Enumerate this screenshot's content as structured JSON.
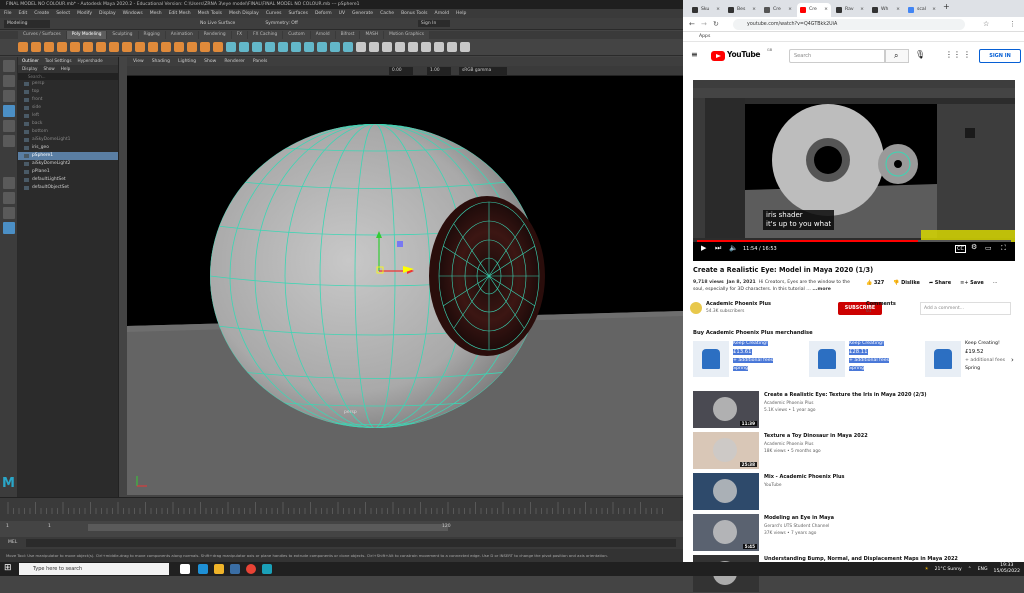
{
  "maya": {
    "title": "FINAL MODEL NO COLOUR.mb* - Autodesk Maya 2020.2 - Educational Version: C:\\Users\\ZRNA 3\\eye model\\FINAL\\FINAL MODEL NO COLOUR.mb --- pSphere1",
    "menu": [
      "File",
      "Edit",
      "Create",
      "Select",
      "Modify",
      "Display",
      "Windows",
      "Mesh",
      "Edit Mesh",
      "Mesh Tools",
      "Mesh Display",
      "Curves",
      "Surfaces",
      "Deform",
      "UV",
      "Generate",
      "Cache",
      "Bonus Tools",
      "Arnold",
      "Help"
    ],
    "mode": "Modeling",
    "no_live_surface": "No Live Surface",
    "symmetry": "Symmetry: Off",
    "sign_in": "Sign In",
    "shelf_tabs": [
      "Curves / Surfaces",
      "Poly Modeling",
      "Sculpting",
      "Rigging",
      "Animation",
      "Rendering",
      "FX",
      "FX Caching",
      "Custom",
      "Arnold",
      "Bifrost",
      "MASH",
      "Motion Graphics"
    ],
    "active_shelf": "Poly Modeling",
    "outliner_tabs": [
      "Outliner",
      "Tool Settings",
      "Hypershade"
    ],
    "outliner_menu": [
      "Display",
      "Show",
      "Help"
    ],
    "outliner_search": "Search...",
    "outliner_items": [
      "persp",
      "top",
      "front",
      "side",
      "left",
      "back",
      "bottom",
      "aiSkyDomeLight1",
      "iris_geo",
      "pSphere1",
      "aiSkyDomeLight2",
      "pPlane1",
      "defaultLightSet",
      "defaultObjectSet"
    ],
    "selected_item": "pSphere1",
    "viewport_menu": [
      "View",
      "Shading",
      "Lighting",
      "Show",
      "Renderer",
      "Panels"
    ],
    "field_1": "0.00",
    "field_2": "1.00",
    "colorspace": "sRGB gamma",
    "camera_label": "persp",
    "range_start": "1",
    "range_end": "120",
    "current_frame": "1",
    "mel_label": "MEL",
    "help_line": "Move Tool: Use manipulator to move object(s). Ctrl+middle-drag to move components along normals. Shift+drag manipulator axis or plane handles to extrude components or clone objects. Ctrl+Shift+Alt to constrain movement to a connected edge. Use D or INSERT to change the pivot position and axis orientation."
  },
  "chrome": {
    "tabs": [
      {
        "label": "Sku",
        "color": "#333333"
      },
      {
        "label": "Bes",
        "color": "#333333"
      },
      {
        "label": "Cre",
        "color": "#555555"
      },
      {
        "label": "Cre",
        "color": "#ff0000"
      },
      {
        "label": "Rav",
        "color": "#333333"
      },
      {
        "label": "Wh",
        "color": "#333333"
      },
      {
        "label": "scal",
        "color": "#4285f4"
      }
    ],
    "active_tab": 3,
    "url": "youtube.com/watch?v=Q4GTBkk2UiA",
    "bookmark": "Apps"
  },
  "youtube": {
    "brand": "YouTube",
    "region": "GB",
    "search_placeholder": "Search",
    "sign_in": "SIGN IN",
    "caption_line1": "iris shader",
    "caption_line2": "it's up to you what",
    "time": "11:54 / 16:53",
    "progress_fraction": 0.705,
    "title": "Create a Realistic Eye: Model in Maya 2020 (1/3)",
    "views": "9,718 views",
    "date": "Jan 8, 2021",
    "desc": "Hi Creators, Eyes are the window to the soul, especially for 3D characters. In this tutorial …",
    "more": "...more",
    "likes": "327",
    "dislike": "Dislike",
    "share": "Share",
    "save": "Save",
    "channel": "Academic Phoenix Plus",
    "subscribers": "54.3K subscribers",
    "subscribe": "SUBSCRIBE",
    "comments_label": "Comments",
    "comments_count": "61",
    "add_comment": "Add a comment...",
    "merch_header": "Buy Academic Phoenix Plus merchandise",
    "merch": [
      {
        "name": "Keep Creating!",
        "price": "£13.61",
        "fees": "+ additional fees",
        "store": "Spring"
      },
      {
        "name": "Keep Creating!",
        "price": "£28.11",
        "fees": "+ additional fees",
        "store": "Spring"
      },
      {
        "name": "Keep Creating!",
        "price": "£19.52",
        "fees": "+ additional fees",
        "store": "Spring"
      }
    ],
    "recommendations": [
      {
        "title": "Create a Realistic Eye: Texture the Iris in Maya 2020 (2/3)",
        "channel": "Academic Phoenix Plus",
        "views": "5.1K views • 1 year ago",
        "duration": "11:39",
        "thumb": "#4a4a52"
      },
      {
        "title": "Texture a Toy Dinosaur in Maya 2022",
        "channel": "Academic Phoenix Plus",
        "views": "18K views • 5 months ago",
        "duration": "25:38",
        "thumb": "#d9c7b7"
      },
      {
        "title": "Mix - Academic Phoenix Plus",
        "channel": "YouTube",
        "views": "",
        "duration": "",
        "thumb": "#2e4a6b"
      },
      {
        "title": "Modeling an Eye in Maya",
        "channel": "Gerard's UTS Student Channel",
        "views": "37K views • 7 years ago",
        "duration": "5:45",
        "thumb": "#5a6270"
      },
      {
        "title": "Understanding Bump, Normal, and Displacement Maps in Maya 2022",
        "channel": "",
        "views": "",
        "duration": "",
        "thumb": "#333333"
      }
    ]
  },
  "taskbar": {
    "search": "Type here to search",
    "weather": "21°C  Sunny",
    "lang": "ENG",
    "time": "19:33",
    "date": "15/05/2022"
  }
}
